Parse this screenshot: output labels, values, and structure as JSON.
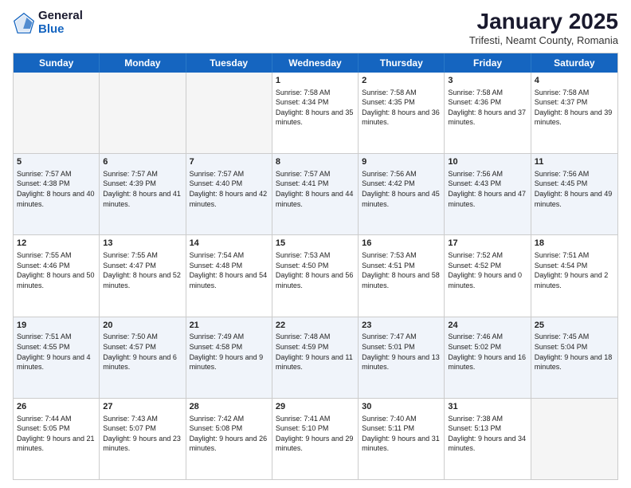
{
  "logo": {
    "general": "General",
    "blue": "Blue"
  },
  "title": {
    "month": "January 2025",
    "location": "Trifesti, Neamt County, Romania"
  },
  "calendar": {
    "headers": [
      "Sunday",
      "Monday",
      "Tuesday",
      "Wednesday",
      "Thursday",
      "Friday",
      "Saturday"
    ],
    "rows": [
      [
        {
          "day": "",
          "text": ""
        },
        {
          "day": "",
          "text": ""
        },
        {
          "day": "",
          "text": ""
        },
        {
          "day": "1",
          "text": "Sunrise: 7:58 AM\nSunset: 4:34 PM\nDaylight: 8 hours and 35 minutes."
        },
        {
          "day": "2",
          "text": "Sunrise: 7:58 AM\nSunset: 4:35 PM\nDaylight: 8 hours and 36 minutes."
        },
        {
          "day": "3",
          "text": "Sunrise: 7:58 AM\nSunset: 4:36 PM\nDaylight: 8 hours and 37 minutes."
        },
        {
          "day": "4",
          "text": "Sunrise: 7:58 AM\nSunset: 4:37 PM\nDaylight: 8 hours and 39 minutes."
        }
      ],
      [
        {
          "day": "5",
          "text": "Sunrise: 7:57 AM\nSunset: 4:38 PM\nDaylight: 8 hours and 40 minutes."
        },
        {
          "day": "6",
          "text": "Sunrise: 7:57 AM\nSunset: 4:39 PM\nDaylight: 8 hours and 41 minutes."
        },
        {
          "day": "7",
          "text": "Sunrise: 7:57 AM\nSunset: 4:40 PM\nDaylight: 8 hours and 42 minutes."
        },
        {
          "day": "8",
          "text": "Sunrise: 7:57 AM\nSunset: 4:41 PM\nDaylight: 8 hours and 44 minutes."
        },
        {
          "day": "9",
          "text": "Sunrise: 7:56 AM\nSunset: 4:42 PM\nDaylight: 8 hours and 45 minutes."
        },
        {
          "day": "10",
          "text": "Sunrise: 7:56 AM\nSunset: 4:43 PM\nDaylight: 8 hours and 47 minutes."
        },
        {
          "day": "11",
          "text": "Sunrise: 7:56 AM\nSunset: 4:45 PM\nDaylight: 8 hours and 49 minutes."
        }
      ],
      [
        {
          "day": "12",
          "text": "Sunrise: 7:55 AM\nSunset: 4:46 PM\nDaylight: 8 hours and 50 minutes."
        },
        {
          "day": "13",
          "text": "Sunrise: 7:55 AM\nSunset: 4:47 PM\nDaylight: 8 hours and 52 minutes."
        },
        {
          "day": "14",
          "text": "Sunrise: 7:54 AM\nSunset: 4:48 PM\nDaylight: 8 hours and 54 minutes."
        },
        {
          "day": "15",
          "text": "Sunrise: 7:53 AM\nSunset: 4:50 PM\nDaylight: 8 hours and 56 minutes."
        },
        {
          "day": "16",
          "text": "Sunrise: 7:53 AM\nSunset: 4:51 PM\nDaylight: 8 hours and 58 minutes."
        },
        {
          "day": "17",
          "text": "Sunrise: 7:52 AM\nSunset: 4:52 PM\nDaylight: 9 hours and 0 minutes."
        },
        {
          "day": "18",
          "text": "Sunrise: 7:51 AM\nSunset: 4:54 PM\nDaylight: 9 hours and 2 minutes."
        }
      ],
      [
        {
          "day": "19",
          "text": "Sunrise: 7:51 AM\nSunset: 4:55 PM\nDaylight: 9 hours and 4 minutes."
        },
        {
          "day": "20",
          "text": "Sunrise: 7:50 AM\nSunset: 4:57 PM\nDaylight: 9 hours and 6 minutes."
        },
        {
          "day": "21",
          "text": "Sunrise: 7:49 AM\nSunset: 4:58 PM\nDaylight: 9 hours and 9 minutes."
        },
        {
          "day": "22",
          "text": "Sunrise: 7:48 AM\nSunset: 4:59 PM\nDaylight: 9 hours and 11 minutes."
        },
        {
          "day": "23",
          "text": "Sunrise: 7:47 AM\nSunset: 5:01 PM\nDaylight: 9 hours and 13 minutes."
        },
        {
          "day": "24",
          "text": "Sunrise: 7:46 AM\nSunset: 5:02 PM\nDaylight: 9 hours and 16 minutes."
        },
        {
          "day": "25",
          "text": "Sunrise: 7:45 AM\nSunset: 5:04 PM\nDaylight: 9 hours and 18 minutes."
        }
      ],
      [
        {
          "day": "26",
          "text": "Sunrise: 7:44 AM\nSunset: 5:05 PM\nDaylight: 9 hours and 21 minutes."
        },
        {
          "day": "27",
          "text": "Sunrise: 7:43 AM\nSunset: 5:07 PM\nDaylight: 9 hours and 23 minutes."
        },
        {
          "day": "28",
          "text": "Sunrise: 7:42 AM\nSunset: 5:08 PM\nDaylight: 9 hours and 26 minutes."
        },
        {
          "day": "29",
          "text": "Sunrise: 7:41 AM\nSunset: 5:10 PM\nDaylight: 9 hours and 29 minutes."
        },
        {
          "day": "30",
          "text": "Sunrise: 7:40 AM\nSunset: 5:11 PM\nDaylight: 9 hours and 31 minutes."
        },
        {
          "day": "31",
          "text": "Sunrise: 7:38 AM\nSunset: 5:13 PM\nDaylight: 9 hours and 34 minutes."
        },
        {
          "day": "",
          "text": ""
        }
      ]
    ]
  }
}
